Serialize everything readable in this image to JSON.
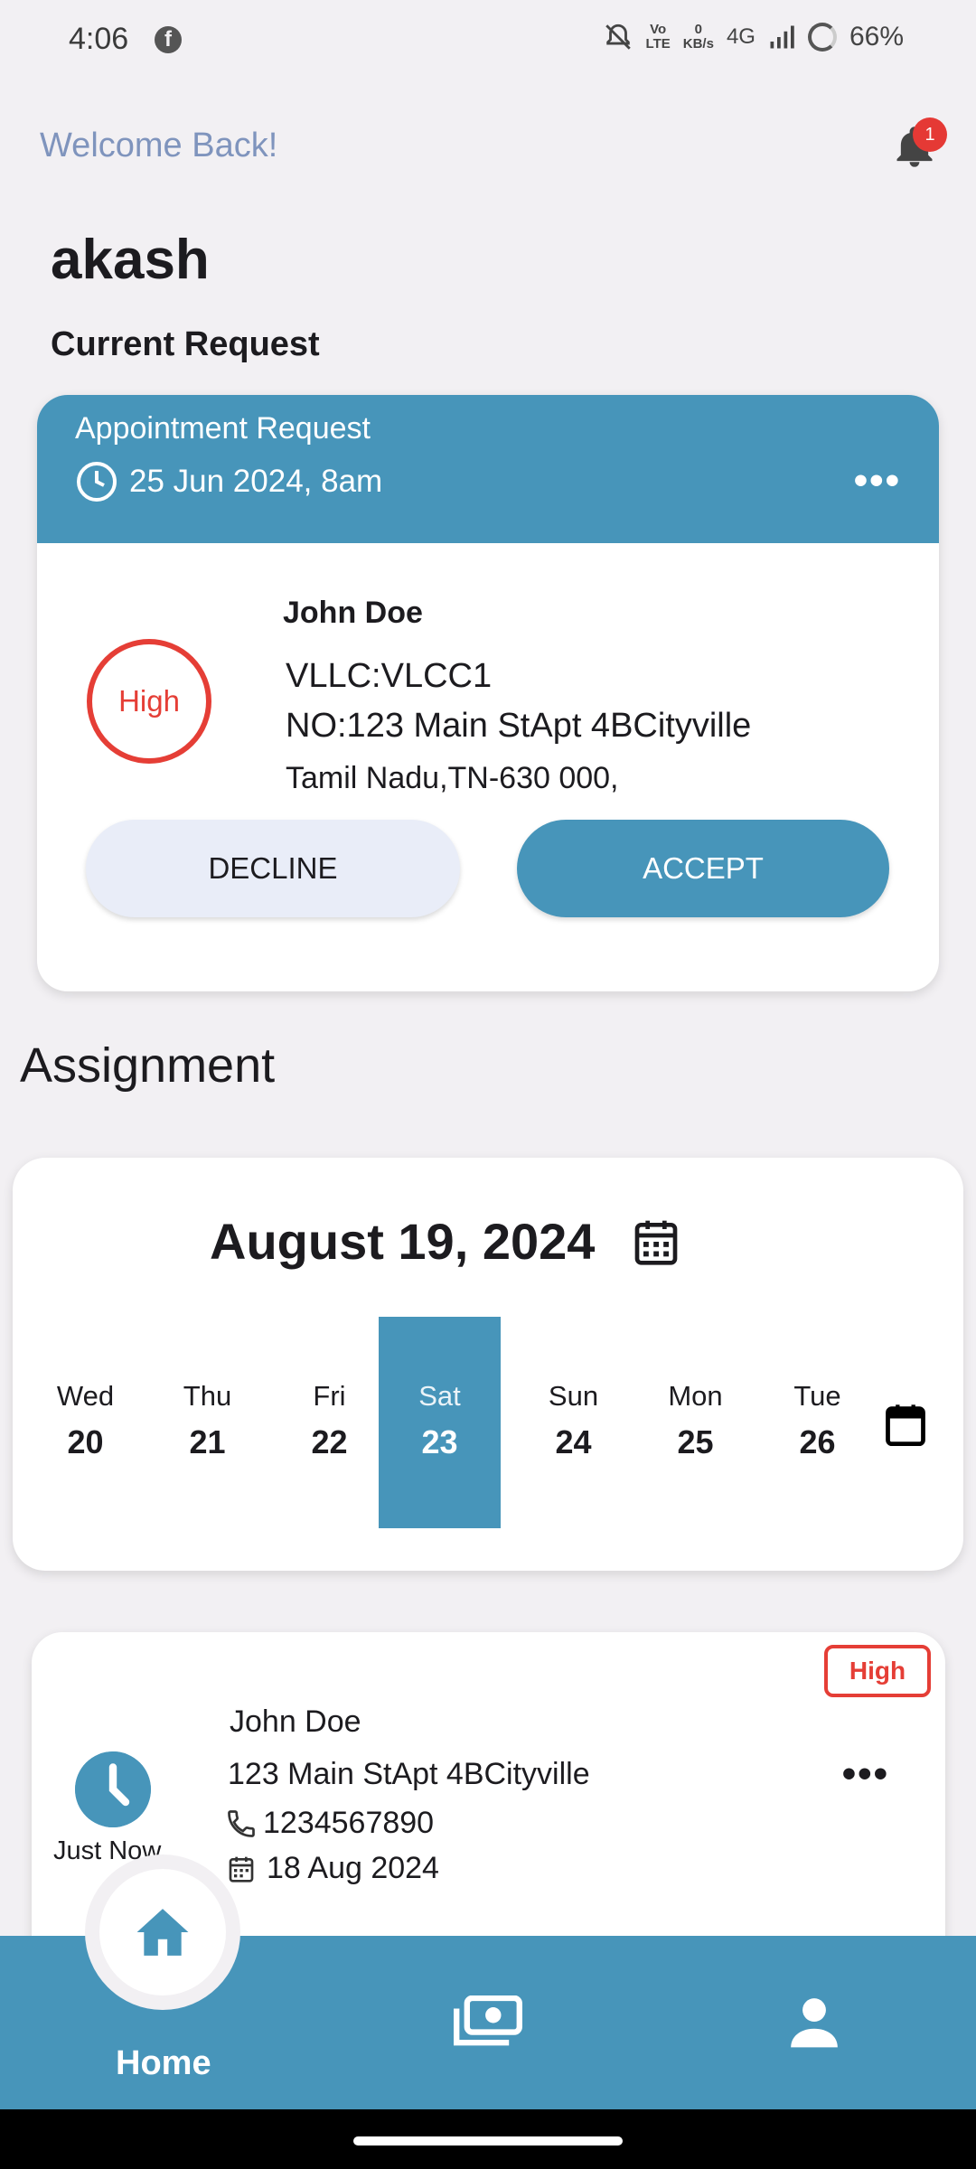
{
  "status_bar": {
    "time": "4:06",
    "volte": "Vo\nLTE",
    "speed": "0\nKB/s",
    "network": "4G",
    "battery": "66%",
    "icons": [
      "facebook-icon",
      "mute-bell-icon",
      "signal-icon",
      "battery-icon"
    ]
  },
  "header": {
    "welcome": "Welcome Back!",
    "notification_count": "1",
    "username": "akash",
    "current_request_label": "Current Request"
  },
  "request_card": {
    "title": "Appointment Request",
    "datetime": "25 Jun 2024, 8am",
    "more": "•••",
    "priority": "High",
    "name": "John Doe",
    "line1": "VLLC:VLCC1",
    "line2": "NO:123 Main StApt 4BCityville",
    "line3": "Tamil Nadu,TN-630 000,",
    "decline_label": "DECLINE",
    "accept_label": "ACCEPT",
    "accent": "#4795ba"
  },
  "assignment": {
    "title": "Assignment",
    "month_label": "August 19, 2024",
    "days": [
      {
        "name": "Wed",
        "date": "20"
      },
      {
        "name": "Thu",
        "date": "21"
      },
      {
        "name": "Fri",
        "date": "22"
      },
      {
        "name": "Sat",
        "date": "23",
        "selected": true
      },
      {
        "name": "Sun",
        "date": "24"
      },
      {
        "name": "Mon",
        "date": "25"
      },
      {
        "name": "Tue",
        "date": "26"
      }
    ]
  },
  "assignment_item": {
    "priority": "High",
    "time_ago": "Just Now",
    "name": "John Doe",
    "address": "123 Main StApt 4BCityville",
    "phone": "1234567890",
    "date": "18 Aug 2024",
    "more": "•••"
  },
  "nav": {
    "home_label": "Home",
    "items": [
      "home-icon",
      "payments-icon",
      "profile-icon"
    ]
  }
}
